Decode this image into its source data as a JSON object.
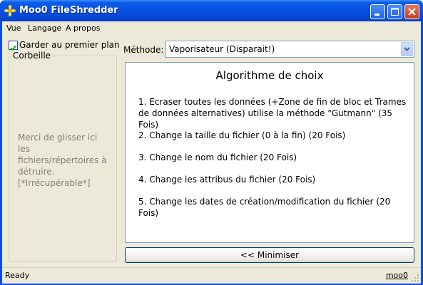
{
  "window": {
    "title": "Moo0 FileShredder"
  },
  "menu": {
    "items": [
      "Vue",
      "Langage",
      "A propos"
    ]
  },
  "options": {
    "keep_on_top_label": "Garder au premier plan",
    "keep_on_top_checked": true
  },
  "trash": {
    "legend": "Corbeille",
    "instructions": "Merci de glisser ici\nles\nfichiers/répertoires à\ndétruire.\n[*Irrécupérable*]"
  },
  "method": {
    "label": "Méthode:",
    "selected": "Vaporisateur (Disparait!)"
  },
  "algorithm": {
    "title": "Algorithme de choix",
    "items": [
      "1. Ecraser toutes les données (+Zone de fin de bloc et Trames de données alternatives) utilise la méthode \"Gutmann\" (35 Fois)",
      "2. Change la taille du fichier (0 à la fin) (20 Fois)",
      "3. Change le nom du fichier (20 Fois)",
      "4. Change les attribus du fichier (20 Fois)",
      "5. Change les dates de création/modification du fichier (20 Fois)"
    ]
  },
  "buttons": {
    "minimize_label": "<< Minimiser"
  },
  "status": {
    "text": "Ready",
    "link": "moo0"
  },
  "colors": {
    "titlebar": "#0650e0",
    "face": "#ece9d8",
    "close": "#c9391a",
    "border": "#7f9db9"
  }
}
